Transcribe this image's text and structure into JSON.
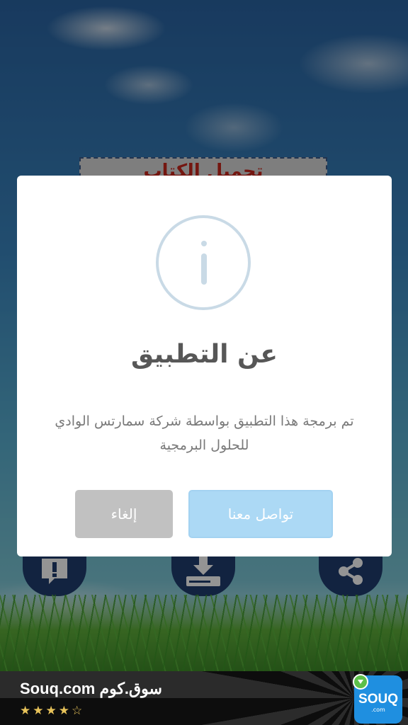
{
  "background": {
    "banner_text": "تحميل الكتاب"
  },
  "dialog": {
    "icon": "info-icon",
    "title": "عن التطبيق",
    "message": "تم برمجة هذا التطبيق بواسطة شركة سمارتس الوادي للحلول البرمجية",
    "cancel_label": "إلغاء",
    "contact_label": "تواصل معنا",
    "colors": {
      "contact_button": "#acd9f5",
      "cancel_button": "#c1c1c1",
      "icon_ring": "#c9dae6"
    }
  },
  "bottom_buttons": [
    {
      "icon": "report-icon"
    },
    {
      "icon": "download-icon"
    },
    {
      "icon": "share-icon"
    }
  ],
  "ad": {
    "title": "Souq.com سوق.كوم",
    "rating_text": "★★★★☆",
    "logo_text": "SOUQ",
    "logo_subtext": ".com",
    "colors": {
      "logo_bg": "#1f8fe0",
      "stars": "#e8c35a"
    }
  }
}
